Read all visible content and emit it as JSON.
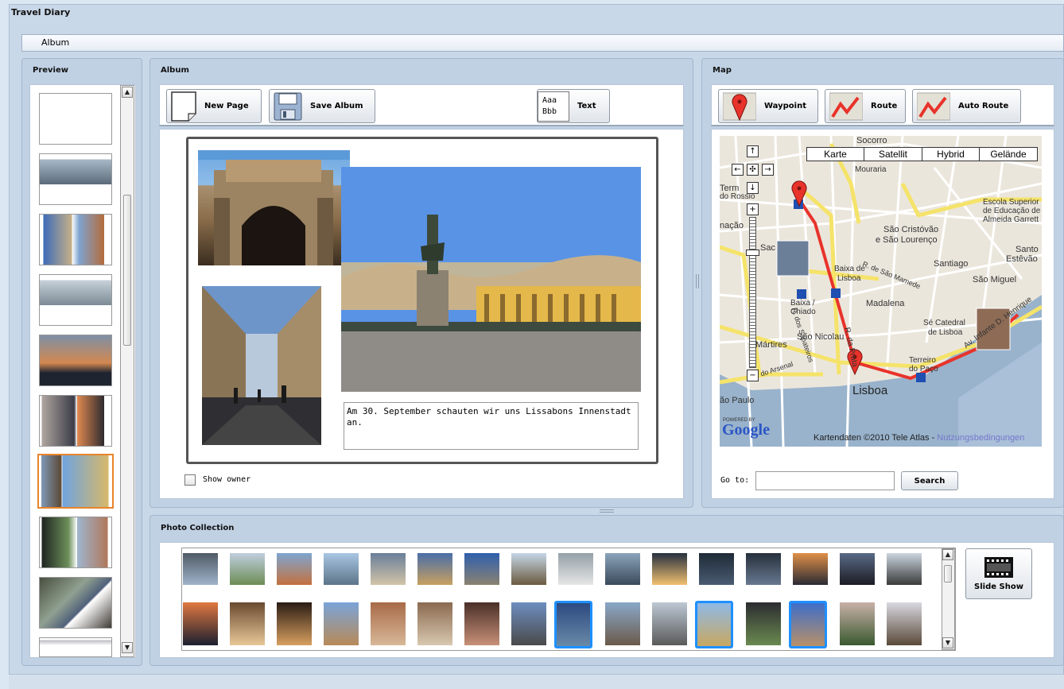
{
  "app": {
    "title": "Travel Diary"
  },
  "menu": {
    "album_label": "Album"
  },
  "preview": {
    "title": "Preview",
    "thumbnail_count": 10,
    "selected_index": 6
  },
  "album": {
    "title": "Album",
    "toolbar": {
      "new_page_label": "New Page",
      "save_album_label": "Save Album",
      "text_label": "Text",
      "text_icon_line1": "Aaa",
      "text_icon_line2": "Bbb"
    },
    "caption": "Am 30. September schauten wir uns Lissabons Innenstadt an.",
    "show_owner_label": "Show owner",
    "show_owner_checked": false
  },
  "map": {
    "title": "Map",
    "toolbar": {
      "waypoint_label": "Waypoint",
      "route_label": "Route",
      "auto_route_label": "Auto Route"
    },
    "type_buttons": [
      "Karte",
      "Satellit",
      "Hybrid",
      "Gelände"
    ],
    "labels": {
      "socorro": "Socorro",
      "mouraria": "Mouraria",
      "rossio": "do Rossio",
      "term": "Term",
      "nacao": "nação",
      "escola1": "Escola Superior",
      "escola2": "de Educação de",
      "escola3": "Almeida Garrett",
      "sao_cristovao1": "São Cristóvão",
      "sao_cristovao2": "e São Lourenço",
      "santiago": "Santiago",
      "santo1": "Santo",
      "santo2": "Estêvão",
      "sao_miguel": "São Miguel",
      "baixa1": "Baixa de",
      "baixa2": "Lisboa",
      "sapateiros": "R. dos Sapateiros",
      "sao_mamede": "R. de São Mamede",
      "baixa_chiado1": "Baixa /",
      "baixa_chiado2": "Chiado",
      "madalena": "Madalena",
      "prata": "R. da Prata",
      "se1": "Sé Catedral",
      "se2": "de Lisboa",
      "sao_nicolau": "São Nicolau",
      "martires": "Mártires",
      "arsenal": "do Arsenal",
      "terreiro1": "Terreiro",
      "terreiro2": "do Paço",
      "av_infante": "Av. Infante D. Henrique",
      "lisboa": "Lisboa",
      "sao_paulo": "ão Paulo",
      "sac": "Sac",
      "powered_by": "POWERED BY",
      "google": "Google",
      "attribution": "Kartendaten ©2010 Tele Atlas - ",
      "terms_link": "Nutzungsbedingungen"
    },
    "goto_label": "Go to:",
    "goto_value": "",
    "search_label": "Search"
  },
  "photo_collection": {
    "title": "Photo Collection",
    "slide_show_label": "Slide Show",
    "selected_indices": [
      8,
      11,
      13
    ]
  },
  "colors": {
    "accent": "#1e90ff",
    "route": "#e8332b",
    "selected_thumb": "#e8842c"
  }
}
